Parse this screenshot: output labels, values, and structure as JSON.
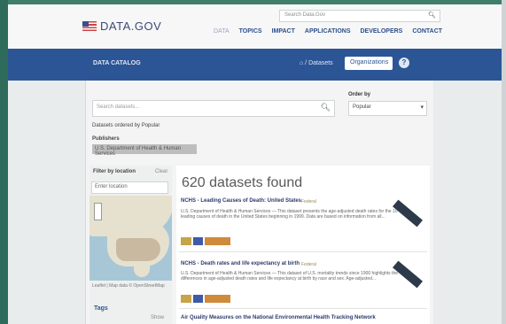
{
  "header": {
    "search_placeholder": "Search Data.Gov",
    "logo_text": "DATA.GOV",
    "nav": [
      "DATA",
      "TOPICS",
      "IMPACT",
      "APPLICATIONS",
      "DEVELOPERS",
      "CONTACT"
    ]
  },
  "bluebar": {
    "title": "DATA CATALOG",
    "datasets_label": "Datasets",
    "organizations_label": "Organizations",
    "help_label": "?"
  },
  "search": {
    "placeholder": "Search datasets...",
    "order_label": "Order by",
    "order_value": "Popular",
    "filters_label": "Datasets ordered by Popular",
    "filter_heading": "Publishers",
    "filter_chip": "U.S. Department of Health & Human Services"
  },
  "map_panel": {
    "heading": "Filter by location",
    "clear": "Clear",
    "location_placeholder": "Enter location",
    "footer": "Leaflet | Map data © OpenStreetMap",
    "tags_heading": "Tags",
    "tags_count": "Show"
  },
  "results": {
    "count_text": "620 datasets found",
    "items": [
      {
        "title": "NCHS - Leading Causes of Death: United States",
        "meta": "Federal",
        "desc": "U.S. Department of Health & Human Services — This dataset presents the age-adjusted death rates for the 10 leading causes of death in the United States beginning in 1999. Data are based on information from all..."
      },
      {
        "title": "NCHS - Death rates and life expectancy at birth",
        "meta": "Federal",
        "desc": "U.S. Department of Health & Human Services — This dataset of U.S. mortality trends since 1900 highlights the differences in age-adjusted death rates and life expectancy at birth by race and sex. Age-adjusted..."
      },
      {
        "title": "Air Quality Measures on the National Environmental Health Tracking Network",
        "meta": "",
        "desc": ""
      }
    ]
  },
  "colors": {
    "brand_blue": "#2c5596",
    "format_yellow": "#c7a34a",
    "format_blue": "#3f5aa6",
    "format_orange": "#cf8a3b"
  }
}
